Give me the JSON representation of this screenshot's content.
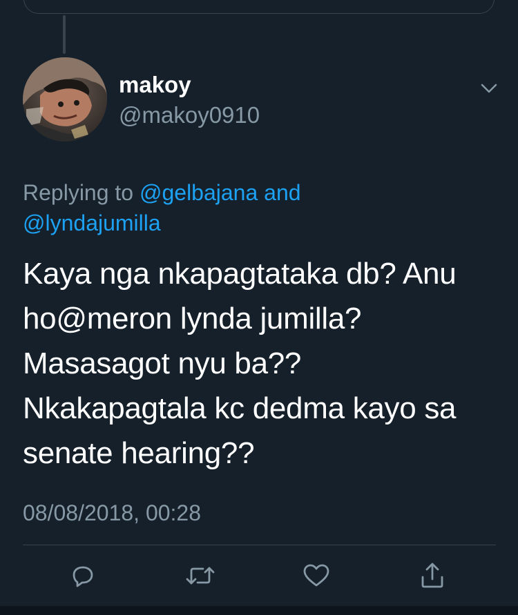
{
  "user": {
    "display_name": "makoy",
    "handle": "@makoy0910"
  },
  "reply_context": {
    "prefix": "Replying to",
    "mention_1": "@gelbajana",
    "joiner": "and",
    "mention_2": "@lyndajumilla"
  },
  "tweet": {
    "lines": [
      "Kaya nga nkapagtataka db? Anu",
      "ho@meron lynda jumilla?",
      "Masasagot nyu ba??",
      "Nkakapagtala kc dedma kayo sa",
      "senate hearing??"
    ],
    "timestamp": "08/08/2018, 00:28"
  },
  "actions": [
    {
      "icon": "reply-icon"
    },
    {
      "icon": "retweet-icon"
    },
    {
      "icon": "like-icon"
    },
    {
      "icon": "share-icon"
    }
  ],
  "colors": {
    "background": "#15202b",
    "text": "#ffffff",
    "secondary": "#8899a6",
    "link": "#1da1f2",
    "border": "#38444d"
  }
}
